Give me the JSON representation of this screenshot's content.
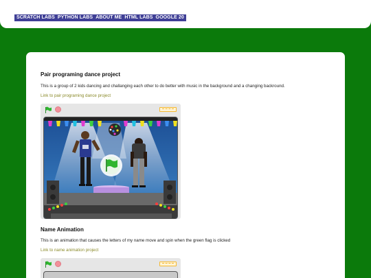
{
  "nav": {
    "items": [
      "SCRATCH LABS",
      "PYTHON LABS",
      "ABOUT ME",
      "HTML LABS",
      "GOOGLE 20"
    ]
  },
  "sections": [
    {
      "title": "Pair programing dance project",
      "description": "This is a group of 2 kids dancing and challanging each other to do better with music in the background and a changing backround.",
      "link": "Link to pair programing dance project"
    },
    {
      "title": "Name Animation",
      "description": "This is an animation that causes the letters of my name move and spin when the green flag is clicked",
      "link": "Link to name animation project"
    }
  ],
  "colors": {
    "background": "#0b7a0b",
    "nav": "#3f3f96",
    "link": "#8a8a2a",
    "flag": "#2fb52f"
  },
  "icons": [
    "green-flag-icon",
    "stop-icon",
    "fullscreen-icon",
    "play-overlay-flag-icon"
  ]
}
